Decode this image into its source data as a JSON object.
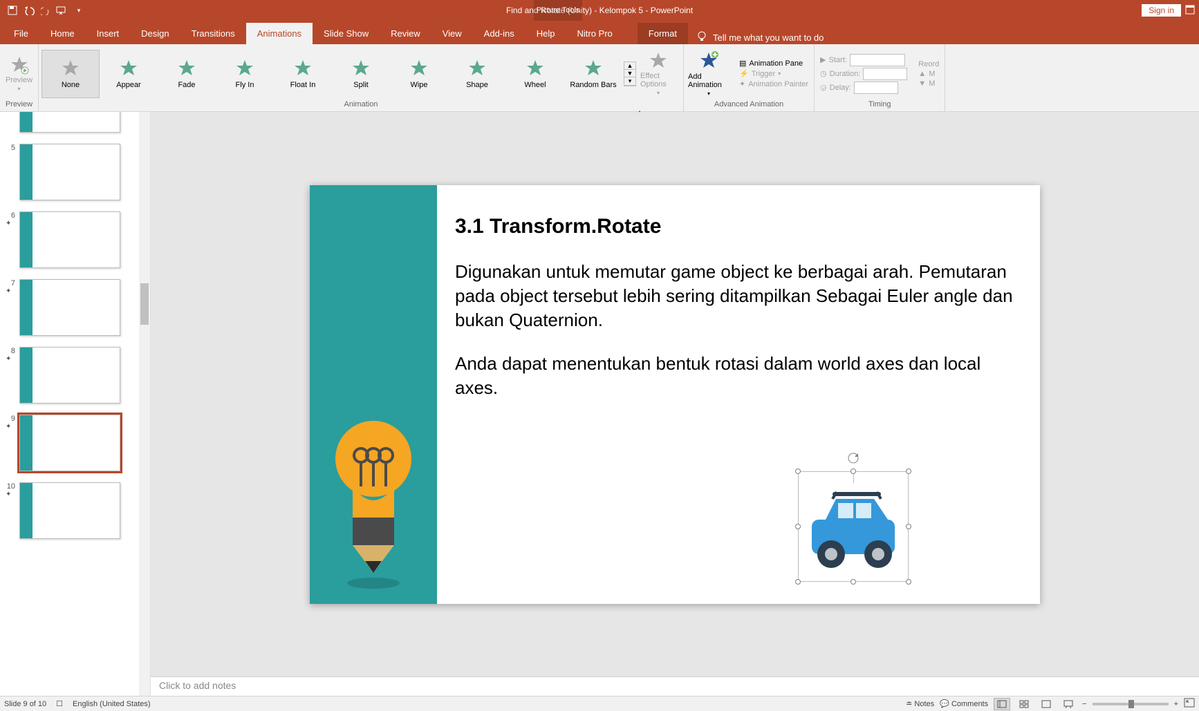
{
  "titlebar": {
    "title": "Find and Rotate (Unity) - Kelompok 5  -  PowerPoint",
    "context_tool": "Picture Tools",
    "sign_in": "Sign in"
  },
  "tabs": {
    "file": "File",
    "home": "Home",
    "insert": "Insert",
    "design": "Design",
    "transitions": "Transitions",
    "animations": "Animations",
    "slideshow": "Slide Show",
    "review": "Review",
    "view": "View",
    "addins": "Add-ins",
    "help": "Help",
    "nitro": "Nitro Pro",
    "format": "Format",
    "tellme": "Tell me what you want to do"
  },
  "ribbon": {
    "preview": {
      "label": "Preview",
      "group": "Preview"
    },
    "animation_group": "Animation",
    "gallery": {
      "none": "None",
      "appear": "Appear",
      "fade": "Fade",
      "flyin": "Fly In",
      "floatin": "Float In",
      "split": "Split",
      "wipe": "Wipe",
      "shape": "Shape",
      "wheel": "Wheel",
      "randombars": "Random Bars"
    },
    "effect_options": "Effect Options",
    "add_animation": "Add Animation",
    "animation_pane": "Animation Pane",
    "trigger": "Trigger",
    "animation_painter": "Animation Painter",
    "advanced_group": "Advanced Animation",
    "timing_group": "Timing",
    "start": "Start:",
    "duration": "Duration:",
    "delay": "Delay:",
    "reorder": "Reord"
  },
  "thumbs": {
    "n4": "",
    "n5": "5",
    "n6": "6",
    "n7": "7",
    "n8": "8",
    "n9": "9",
    "n10": "10"
  },
  "slide": {
    "heading": "3.1 Transform.Rotate",
    "p1": "Digunakan untuk memutar game object ke berbagai arah. Pemutaran pada object tersebut lebih sering ditampilkan Sebagai Euler angle dan bukan Quaternion.",
    "p2": "Anda dapat menentukan bentuk rotasi dalam world axes dan local axes."
  },
  "notes": {
    "placeholder": "Click to add notes"
  },
  "status": {
    "slide_of": "Slide 9 of 10",
    "language": "English (United States)",
    "notes": "Notes",
    "comments": "Comments"
  }
}
